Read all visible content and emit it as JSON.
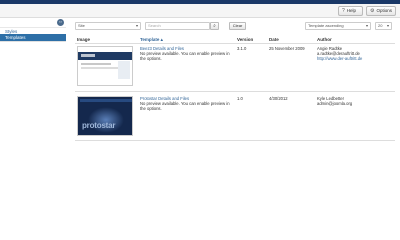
{
  "toolbar": {
    "help_label": "Help",
    "options_label": "Options",
    "help_icon": "question-icon",
    "options_icon": "gear-icon"
  },
  "sidebar": {
    "items": [
      {
        "label": "Styles",
        "active": false
      },
      {
        "label": "Templates",
        "active": true
      }
    ]
  },
  "filters": {
    "site_select": "Site",
    "search_placeholder": "Search",
    "search_icon": "search-icon",
    "clear_label": "Clear",
    "order_select": "Template ascending",
    "limit_select": "20"
  },
  "table": {
    "headers": {
      "image": "Image",
      "template": "Template ▴",
      "version": "Version",
      "date": "Date",
      "author": "Author"
    },
    "rows": [
      {
        "name": "Beez3 Details and Files",
        "preview": "No preview available. You can enable preview in the options.",
        "version": "3.1.0",
        "date": "25 November 2009",
        "author_name": "Angie Radtke",
        "author_email": "a.radtke@derauftritt.de",
        "author_url": "http://www.der-auftritt.de"
      },
      {
        "name": "Protostar Details and Files",
        "preview": "No preview available. You can enable preview in the options.",
        "version": "1.0",
        "date": "4/30/2012",
        "author_name": "Kyle Ledbetter",
        "author_email": "admin@joomla.org",
        "author_url": ""
      }
    ]
  },
  "thumbnails": {
    "protostar_text": "protostar"
  },
  "colors": {
    "header_bar": "#1a3867",
    "active_sidebar": "#2d6fa7",
    "link": "#336699"
  }
}
